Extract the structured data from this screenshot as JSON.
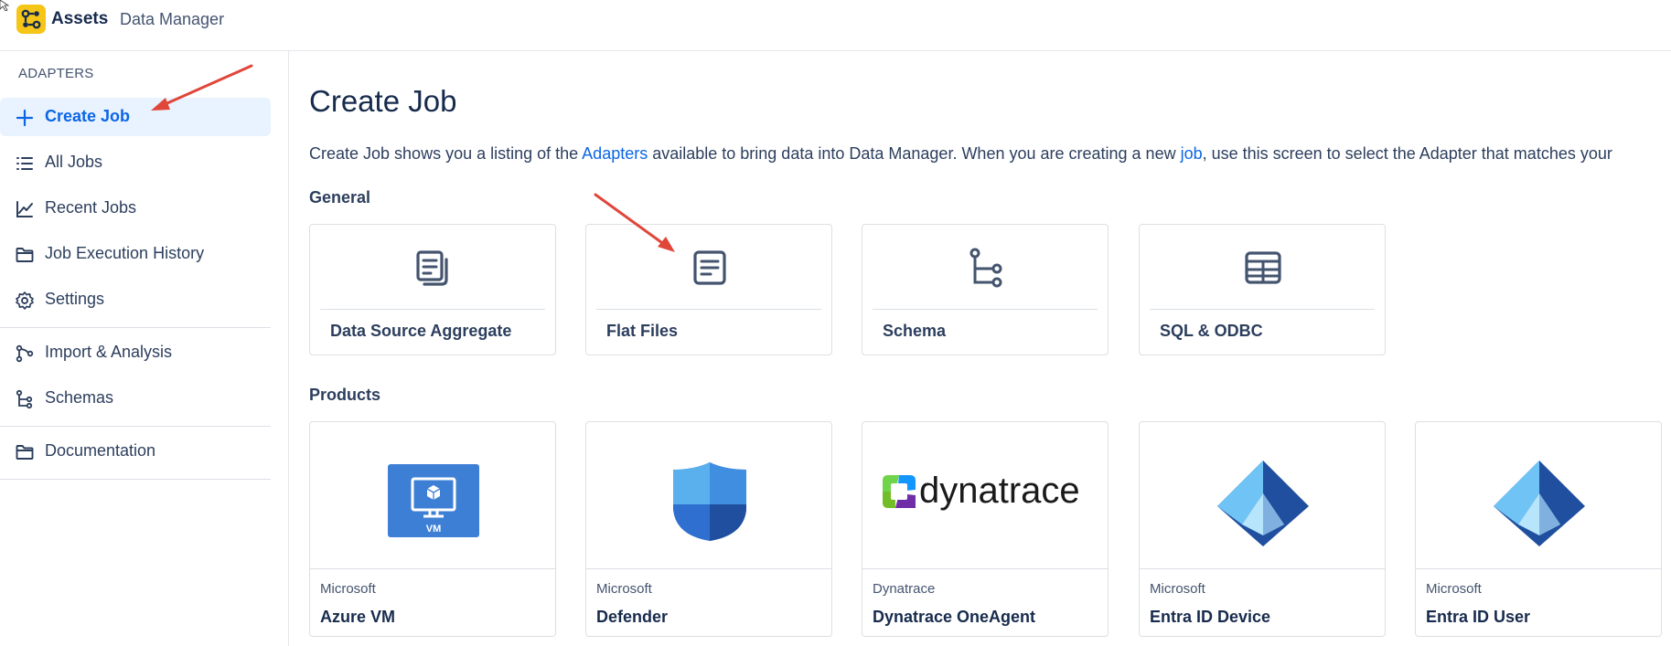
{
  "header": {
    "app_name": "Assets",
    "app_section": "Data Manager"
  },
  "sidebar": {
    "section_label": "ADAPTERS",
    "items": [
      {
        "label": "Create Job",
        "icon": "plus-icon",
        "active": true
      },
      {
        "label": "All Jobs",
        "icon": "list-icon"
      },
      {
        "label": "Recent Jobs",
        "icon": "line-chart-icon"
      },
      {
        "label": "Job Execution History",
        "icon": "folder-icon"
      },
      {
        "label": "Settings",
        "icon": "gear-icon"
      },
      {
        "label": "Import & Analysis",
        "icon": "branch-icon"
      },
      {
        "label": "Schemas",
        "icon": "hierarchy-icon"
      },
      {
        "label": "Documentation",
        "icon": "folder-icon"
      }
    ]
  },
  "main": {
    "title": "Create Job",
    "intro": {
      "text_1": "Create Job shows you a listing of the ",
      "link_1": "Adapters",
      "text_2": " available to bring data into Data Manager. When you are creating a new ",
      "link_2": "job",
      "text_3": ", use this screen to select the Adapter that matches your"
    },
    "general": {
      "title": "General",
      "cards": [
        {
          "title": "Data Source Aggregate",
          "icon": "documents-icon"
        },
        {
          "title": "Flat Files",
          "icon": "document-icon"
        },
        {
          "title": "Schema",
          "icon": "schema-icon"
        },
        {
          "title": "SQL & ODBC",
          "icon": "table-icon"
        }
      ]
    },
    "products": {
      "title": "Products",
      "cards": [
        {
          "vendor": "Microsoft",
          "title": "Azure VM",
          "logo": "azure-vm-logo",
          "logo_text": "VM"
        },
        {
          "vendor": "Microsoft",
          "title": "Defender",
          "logo": "defender-shield-logo"
        },
        {
          "vendor": "Dynatrace",
          "title": "Dynatrace OneAgent",
          "logo": "dynatrace-logo",
          "logo_text": "dynatrace"
        },
        {
          "vendor": "Microsoft",
          "title": "Entra ID Device",
          "logo": "entra-id-logo"
        },
        {
          "vendor": "Microsoft",
          "title": "Entra ID User",
          "logo": "entra-id-logo"
        }
      ]
    }
  },
  "colors": {
    "accent": "#0c66e4",
    "active_bg": "#e9f2ff",
    "annotation_arrow": "#e0463a",
    "logo_yellow": "#f5c518"
  }
}
